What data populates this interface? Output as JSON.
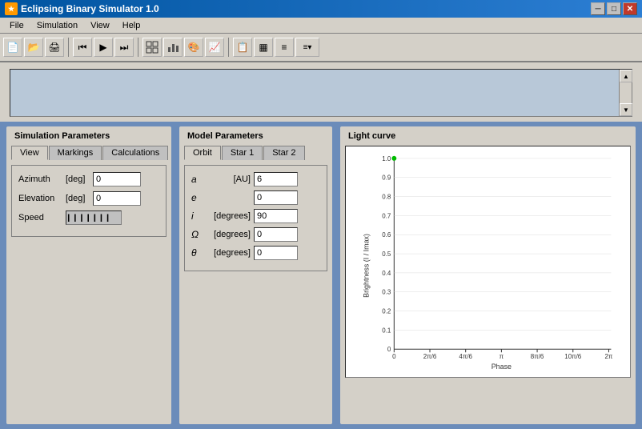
{
  "window": {
    "title": "Eclipsing Binary Simulator  1.0",
    "icon": "★"
  },
  "window_controls": {
    "minimize": "─",
    "maximize": "□",
    "close": "✕"
  },
  "menu": {
    "items": [
      "File",
      "Simulation",
      "View",
      "Help"
    ]
  },
  "toolbar": {
    "buttons": [
      "📄",
      "📂",
      "🖨",
      "|",
      "⏮",
      "▶",
      "⏭",
      "|",
      "⚙",
      "📊",
      "🎨",
      "📈",
      "|",
      "📋",
      "▦",
      "≡",
      "≡▾"
    ]
  },
  "sim_panel": {
    "title": "Simulation Parameters",
    "tabs": [
      "View",
      "Markings",
      "Calculations"
    ],
    "active_tab": "View",
    "fields": {
      "azimuth": {
        "label": "Azimuth",
        "unit": "[deg]",
        "value": "0"
      },
      "elevation": {
        "label": "Elevation",
        "unit": "[deg]",
        "value": "0"
      },
      "speed": {
        "label": "Speed"
      }
    }
  },
  "model_panel": {
    "title": "Model Parameters",
    "tabs": [
      "Orbit",
      "Star 1",
      "Star 2"
    ],
    "active_tab": "Orbit",
    "fields": [
      {
        "label": "a",
        "unit": "[AU]",
        "value": "6"
      },
      {
        "label": "e",
        "unit": "",
        "value": "0"
      },
      {
        "label": "i",
        "unit": "[degrees]",
        "value": "90"
      },
      {
        "label": "Ω",
        "unit": "[degrees]",
        "value": "0"
      },
      {
        "label": "θ",
        "unit": "[degrees]",
        "value": "0"
      }
    ]
  },
  "light_curve": {
    "title": "Light curve",
    "y_axis_label": "Brightness (I / Imax)",
    "x_axis_label": "Phase",
    "y_ticks": [
      "0.1",
      "0.2",
      "0.3",
      "0.4",
      "0.5",
      "0.6",
      "0.7",
      "0.8",
      "0.9",
      "1.0"
    ],
    "x_ticks": [
      "0",
      "2π/6",
      "4π/6",
      "π",
      "8π/6",
      "10π/6",
      "2π"
    ],
    "data_point": {
      "x": 0,
      "y": 1.0
    }
  }
}
